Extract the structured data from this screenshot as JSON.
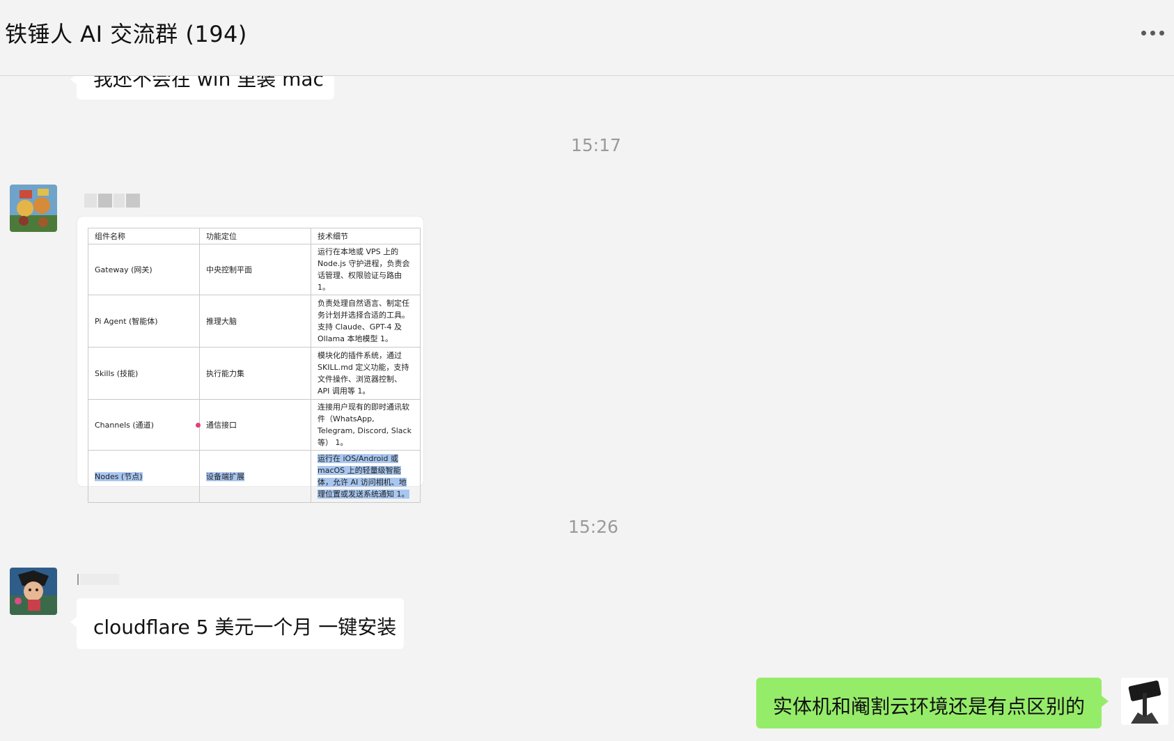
{
  "header": {
    "title": "铁锤人 AI 交流群 (194)",
    "more_icon": "more-dots-icon"
  },
  "messages": {
    "partial_text": "我还不会在 win 里装 mac",
    "time1": "15:17",
    "time2": "15:26",
    "cloudflare_text": "cloudflare 5 美元一个月 一键安装",
    "my_text": "实体机和阉割云环境还是有点区别的"
  },
  "spec_table": {
    "headers": [
      "组件名称",
      "功能定位",
      "技术细节"
    ],
    "rows": [
      [
        "Gateway (网关)",
        "中央控制平面",
        "运行在本地或 VPS 上的 Node.js 守护进程，负责会话管理、权限验证与路由 1。"
      ],
      [
        "Pi Agent (智能体)",
        "推理大脑",
        "负责处理自然语言、制定任务计划并选择合适的工具。支持 Claude、GPT-4 及 Ollama 本地模型 1。"
      ],
      [
        "Skills (技能)",
        "执行能力集",
        "模块化的插件系统，通过 SKILL.md 定义功能，支持文件操作、浏览器控制、API 调用等 1。"
      ],
      [
        "Channels (通道)",
        "通信接口",
        "连接用户现有的即时通讯软件（WhatsApp, Telegram, Discord, Slack 等） 1。"
      ],
      [
        "Nodes (节点)",
        "设备端扩展",
        "运行在 iOS/Android 或 macOS 上的轻量级智能体，允许 AI 访问相机、地理位置或发送系统通知 1。"
      ]
    ]
  }
}
